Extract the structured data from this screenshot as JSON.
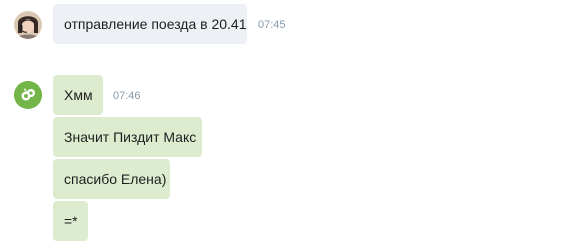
{
  "chat": {
    "messages": [
      {
        "avatar_icon": "woman-with-headset-avatar-icon",
        "text": "отправление поезда в 20.41",
        "time": "07:45",
        "bubble_color": "#edf0f5"
      },
      {
        "avatar_icon": "green-logo-avatar-icon",
        "avatar_color": "#74b54a",
        "bubble_color": "#ddeccf",
        "time": "07:46",
        "lines": [
          "Хмм",
          "Значит Пиздит Макс",
          "спасибо Елена)",
          "=*"
        ]
      }
    ]
  }
}
